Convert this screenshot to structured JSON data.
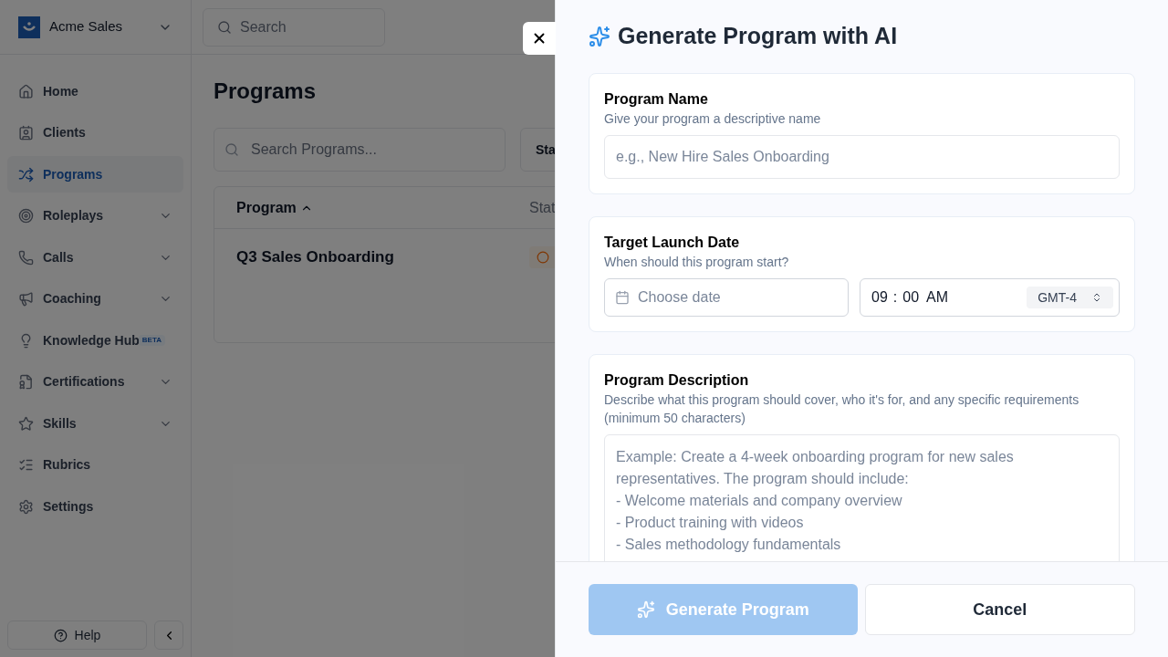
{
  "sidebar": {
    "workspace": "Acme Sales",
    "items": [
      {
        "label": "Home",
        "selected": false,
        "expandable": false
      },
      {
        "label": "Clients",
        "selected": false,
        "expandable": false
      },
      {
        "label": "Programs",
        "selected": true,
        "expandable": false
      },
      {
        "label": "Roleplays",
        "selected": false,
        "expandable": true
      },
      {
        "label": "Calls",
        "selected": false,
        "expandable": true
      },
      {
        "label": "Coaching",
        "selected": false,
        "expandable": true
      },
      {
        "label": "Knowledge Hub",
        "selected": false,
        "expandable": false,
        "badge": "BETA"
      },
      {
        "label": "Certifications",
        "selected": false,
        "expandable": true
      },
      {
        "label": "Skills",
        "selected": false,
        "expandable": true
      },
      {
        "label": "Rubrics",
        "selected": false,
        "expandable": false
      },
      {
        "label": "Settings",
        "selected": false,
        "expandable": false
      }
    ],
    "help": "Help"
  },
  "topbar": {
    "search_placeholder": "Search"
  },
  "page": {
    "title": "Programs",
    "search_placeholder": "Search Programs...",
    "filter": "Sta",
    "table": {
      "columns": [
        "Program",
        "Stat"
      ],
      "rows": [
        {
          "program": "Q3 Sales Onboarding"
        }
      ]
    }
  },
  "dialog": {
    "title": "Generate Program with AI",
    "name": {
      "label": "Program Name",
      "hint": "Give your program a descriptive name",
      "placeholder": "e.g., New Hire Sales Onboarding"
    },
    "launch": {
      "label": "Target Launch Date",
      "hint": "When should this program start?",
      "date_placeholder": "Choose date",
      "hour": "09",
      "separator": ":",
      "minute": "00",
      "period": "AM",
      "timezone": "GMT-4"
    },
    "description": {
      "label": "Program Description",
      "hint": "Describe what this program should cover, who it's for, and any specific requirements (minimum 50 characters)",
      "placeholder_lines": [
        "Example: Create a 4-week onboarding program for new sales representatives. The program should include:",
        "- Welcome materials and company overview",
        "- Product training with videos",
        "- Sales methodology fundamentals"
      ]
    },
    "generate": {
      "label": "Generate Program",
      "disabled": true
    },
    "cancel": "Cancel"
  }
}
